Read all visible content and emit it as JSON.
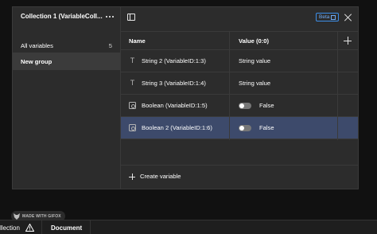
{
  "collection": {
    "title": "Collection 1 (VariableColl...",
    "groups": [
      {
        "label": "All variables",
        "count": "5"
      },
      {
        "label": "New group",
        "count": ""
      }
    ]
  },
  "toolbar": {
    "beta_label": "Beta"
  },
  "table": {
    "headers": {
      "name": "Name",
      "value": "Value (0:0)"
    },
    "rows": [
      {
        "type": "string",
        "name": "String 2 (VariableID:1:3)",
        "value": "String value"
      },
      {
        "type": "string",
        "name": "String 3 (VariableID:1:4)",
        "value": "String value"
      },
      {
        "type": "boolean",
        "name": "Boolean (VariableID:1:5)",
        "value": "False"
      },
      {
        "type": "boolean",
        "name": "Boolean 2 (VariableID:1:6)",
        "value": "False"
      }
    ]
  },
  "create_label": "Create variable",
  "bottom": {
    "collection_tab": "llection",
    "document_tab": "Document"
  },
  "watermark": "MADE WITH GIFOX",
  "colors": {
    "selected_row": "#3d4a6b",
    "beta_accent": "#3c8ee8",
    "panel_bg": "#2c2c2c"
  }
}
